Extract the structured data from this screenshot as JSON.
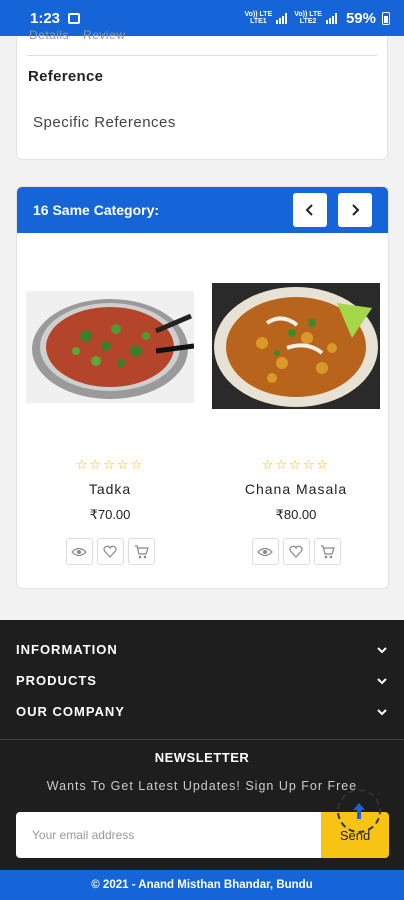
{
  "status_bar": {
    "time": "1:23",
    "network_1": "Vo)) LTE\nLTE1",
    "network_2": "Vo)) LTE\nLTE2",
    "battery": "59%"
  },
  "reference_card": {
    "tabs_cut": [
      "Details",
      "Review"
    ],
    "title": "Reference",
    "text": "Specific References"
  },
  "same_category": {
    "title": "16 Same Category:",
    "prev_icon": "chevron-left-icon",
    "next_icon": "chevron-right-icon",
    "products": [
      {
        "name": "Tadka",
        "price": "₹70.00",
        "rating": "☆☆☆☆☆",
        "image": "tadka-dish-photo"
      },
      {
        "name": "Chana Masala",
        "price": "₹80.00",
        "rating": "☆☆☆☆☆",
        "image": "chana-masala-dish-photo"
      }
    ]
  },
  "footer": {
    "items": [
      {
        "label": "INFORMATION"
      },
      {
        "label": "PRODUCTS"
      },
      {
        "label": "OUR COMPANY"
      }
    ],
    "newsletter_title": "NEWSLETTER",
    "newsletter_text": "Wants To Get Latest Updates! Sign Up For Free",
    "email_placeholder": "Your email address",
    "send_label": "Send"
  },
  "copyright": "© 2021 - Anand Misthan Bhandar, Bundu",
  "colors": {
    "primary_blue": "#1565d8",
    "accent_yellow": "#f7c413",
    "footer_dark": "#1e1e1e",
    "star": "#f4b400"
  }
}
